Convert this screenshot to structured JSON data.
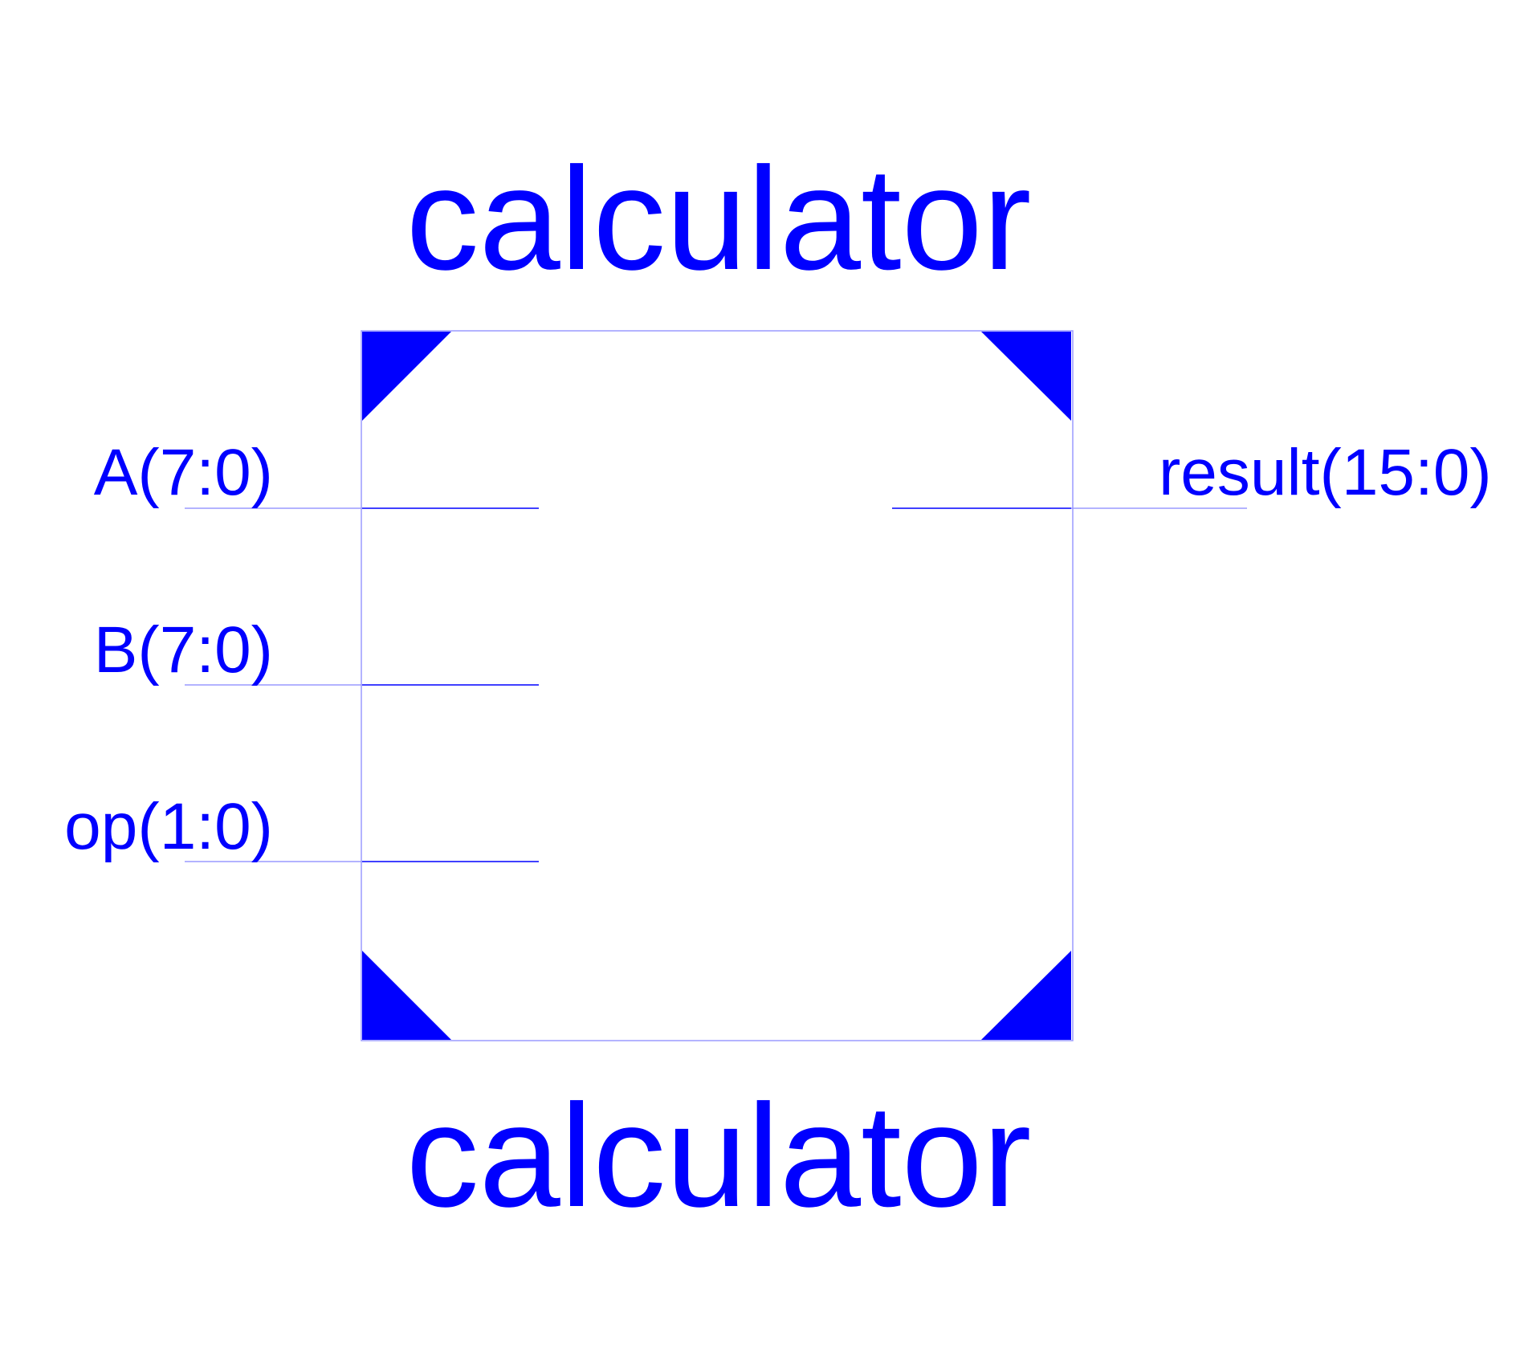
{
  "symbol": {
    "name_top": "calculator",
    "name_bottom": "calculator",
    "color": "#0000ff",
    "outline_color": "#9a9aff"
  },
  "ports": {
    "inputs": [
      {
        "label": "A(7:0)",
        "direction": "input",
        "bus_width": "7:0"
      },
      {
        "label": "B(7:0)",
        "direction": "input",
        "bus_width": "7:0"
      },
      {
        "label": "op(1:0)",
        "direction": "input",
        "bus_width": "1:0"
      }
    ],
    "outputs": [
      {
        "label": "result(15:0)",
        "direction": "output",
        "bus_width": "15:0"
      }
    ]
  }
}
